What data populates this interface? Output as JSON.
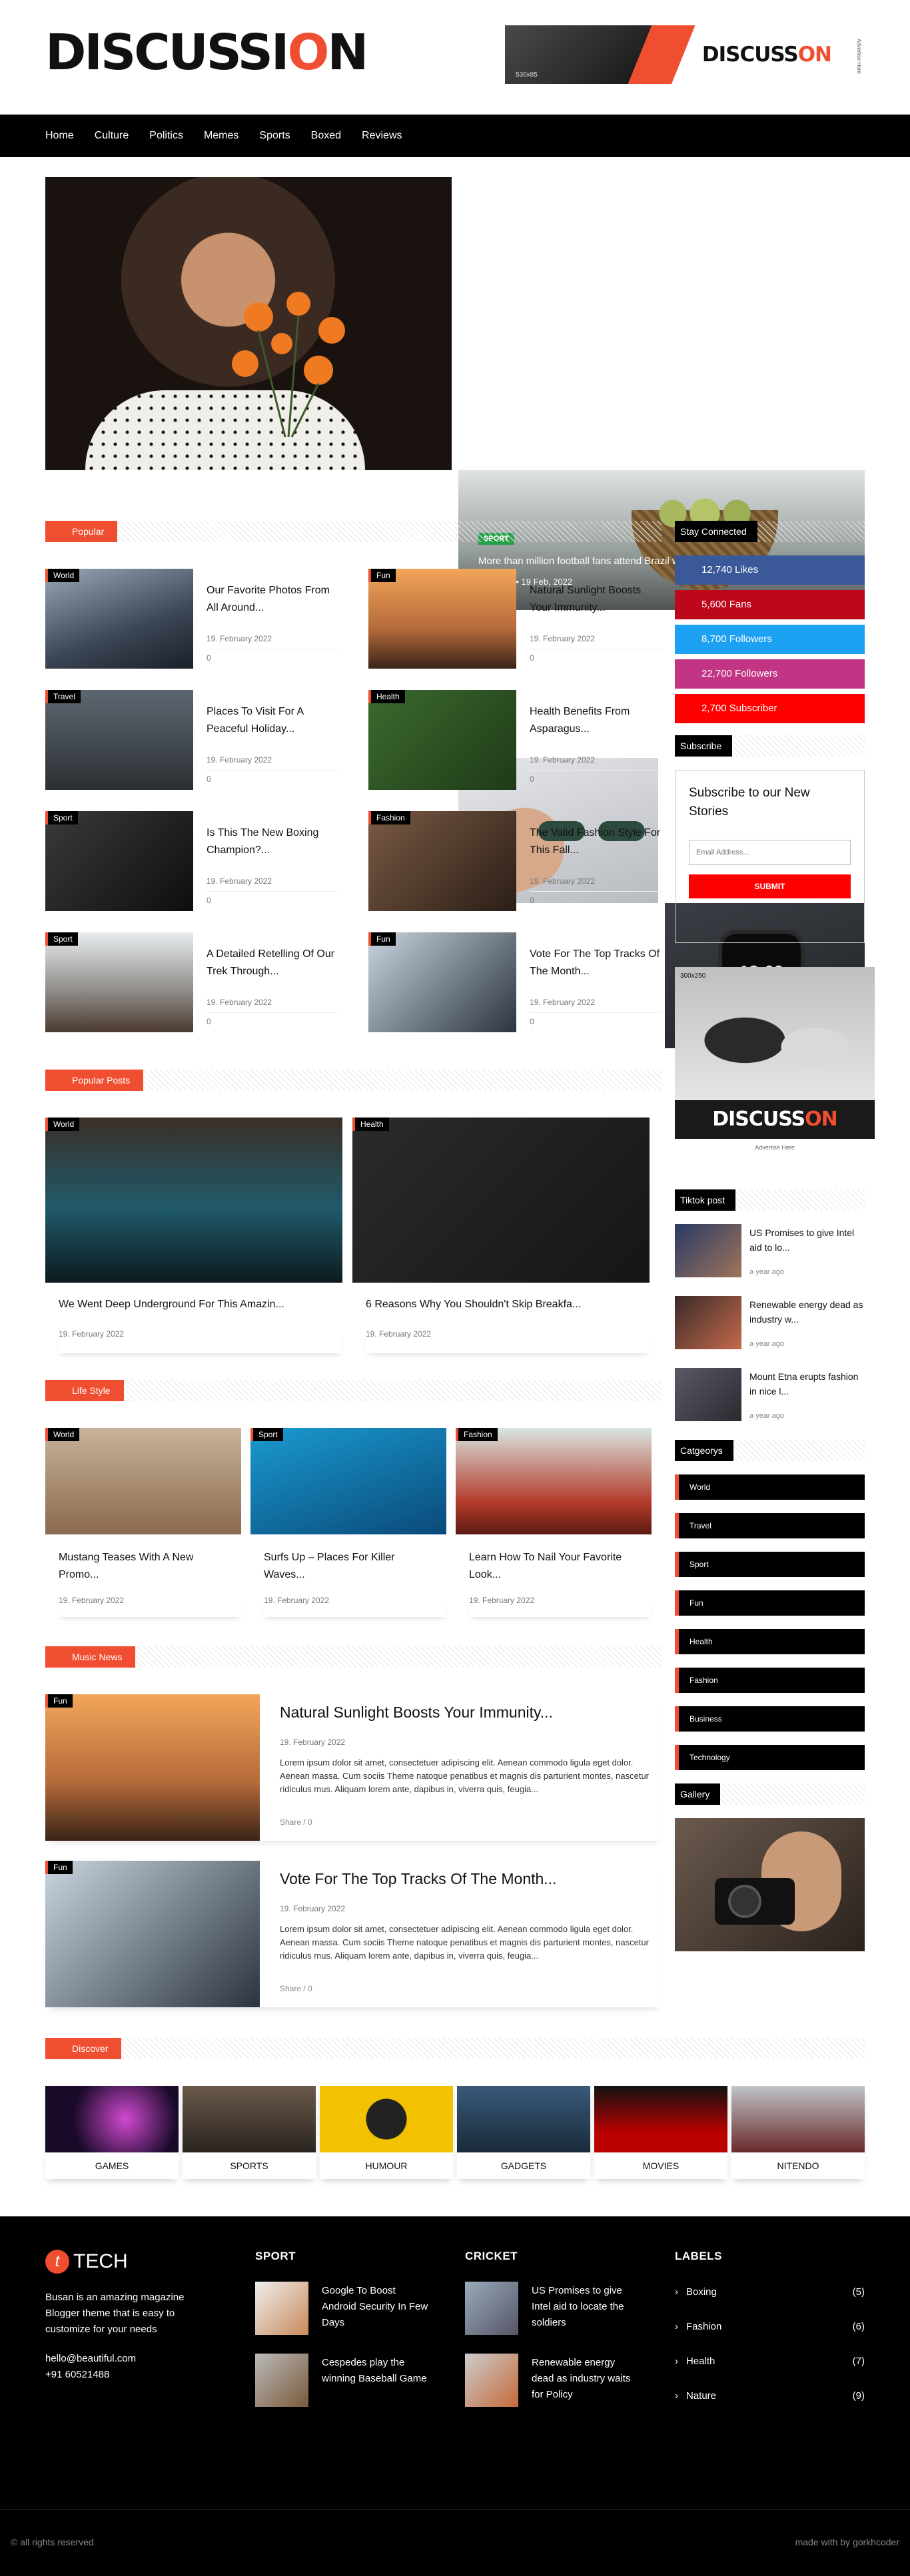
{
  "brand": {
    "logo_pre": "DISCUSSI",
    "logo_o": "O",
    "logo_post": "N"
  },
  "header_ad": {
    "size": "530x85",
    "logo_pre": "DISCUSS",
    "logo_post": "ON",
    "tag": "Advertise Here"
  },
  "nav": [
    "Home",
    "Culture",
    "Politics",
    "Memes",
    "Sports",
    "Boxed",
    "Reviews"
  ],
  "hero": {
    "top": {
      "badge": "SPORT",
      "title": "More than million football fans attend Brazil world cup",
      "meta": "by admin • 19 Feb, 2022"
    },
    "watch_time": "13:09"
  },
  "popular": {
    "label": "Popular",
    "items": [
      {
        "cat": "World",
        "title": "Our Favorite Photos From All Around...",
        "date": "19. February 2022",
        "count": "0"
      },
      {
        "cat": "Fun",
        "title": "Natural Sunlight Boosts Your Immunity...",
        "date": "19. February 2022",
        "count": "0"
      },
      {
        "cat": "Travel",
        "title": "Places To Visit For A Peaceful Holiday...",
        "date": "19. February 2022",
        "count": "0"
      },
      {
        "cat": "Health",
        "title": "Health Benefits From Asparagus...",
        "date": "19. February 2022",
        "count": "0"
      },
      {
        "cat": "Sport",
        "title": "Is This The New Boxing Champion?...",
        "date": "19. February 2022",
        "count": "0"
      },
      {
        "cat": "Fashion",
        "title": "The Valid Fashion Style For This Fall...",
        "date": "19. February 2022",
        "count": "0"
      },
      {
        "cat": "Sport",
        "title": "A Detailed Retelling Of Our Trek Through...",
        "date": "19. February 2022",
        "count": "0"
      },
      {
        "cat": "Fun",
        "title": "Vote For The Top Tracks Of The Month...",
        "date": "19. February 2022",
        "count": "0"
      }
    ]
  },
  "popular_posts": {
    "label": "Popular Posts",
    "items": [
      {
        "cat": "World",
        "title": "We Went Deep Underground For This Amazin...",
        "date": "19. February 2022"
      },
      {
        "cat": "Health",
        "title": "6 Reasons Why You Shouldn't Skip Breakfa...",
        "date": "19. February 2022"
      }
    ]
  },
  "life_style": {
    "label": "Life Style",
    "items": [
      {
        "cat": "World",
        "title": "Mustang Teases With A New Promo...",
        "date": "19. February 2022"
      },
      {
        "cat": "Sport",
        "title": "Surfs Up – Places For Killer Waves...",
        "date": "19. February 2022"
      },
      {
        "cat": "Fashion",
        "title": "Learn How To Nail Your Favorite Look...",
        "date": "19. February 2022"
      }
    ]
  },
  "music_news": {
    "label": "Music News",
    "items": [
      {
        "cat": "Fun",
        "title": "Natural Sunlight Boosts Your Immunity...",
        "date": "19. February 2022",
        "excerpt": "Lorem ipsum dolor sit amet, consectetuer adipiscing elit. Aenean commodo ligula eget dolor. Aenean massa. Cum sociis Theme natoque penatibus et magnis dis parturient montes, nascetur ridiculus mus. Aliquam lorem ante, dapibus in, viverra quis, feugia...",
        "share": "Share / 0"
      },
      {
        "cat": "Fun",
        "title": "Vote For The Top Tracks Of The Month...",
        "date": "19. February 2022",
        "excerpt": "Lorem ipsum dolor sit amet, consectetuer adipiscing elit. Aenean commodo ligula eget dolor. Aenean massa. Cum sociis Theme natoque penatibus et magnis dis parturient montes, nascetur ridiculus mus. Aliquam lorem ante, dapibus in, viverra quis, feugia...",
        "share": "Share / 0"
      }
    ]
  },
  "sidebar": {
    "stay_connected": "Stay Connected",
    "social": [
      {
        "text": "12,740 Likes",
        "color": "#3b5998"
      },
      {
        "text": "5,600 Fans",
        "color": "#bd081c"
      },
      {
        "text": "8,700 Followers",
        "color": "#1da1f2"
      },
      {
        "text": "22,700 Followers",
        "color": "#c13584"
      },
      {
        "text": "2,700 Subscriber",
        "color": "#ff0000"
      }
    ],
    "subscribe_label": "Subscribe",
    "subscribe_heading": "Subscribe to our New Stories",
    "email_placeholder": "Email Address...",
    "submit": "SUBMIT",
    "ad": {
      "size": "300x250",
      "logo_pre": "DISCUSS",
      "logo_post": "ON",
      "note": "Advertise Here"
    },
    "tiktok_label": "Tiktok post",
    "tiktok": [
      {
        "title": "US Promises to give Intel aid to lo...",
        "date": "a year ago"
      },
      {
        "title": "Renewable energy dead as industry w...",
        "date": "a year ago"
      },
      {
        "title": "Mount Etna erupts fashion in nice l...",
        "date": "a year ago"
      }
    ],
    "categories_label": "Catgeorys",
    "categories": [
      "World",
      "Travel",
      "Sport",
      "Fun",
      "Health",
      "Fashion",
      "Business",
      "Technology"
    ],
    "gallery_label": "Gallery"
  },
  "discover": {
    "label": "Discover",
    "items": [
      "GAMES",
      "SPORTS",
      "HUMOUR",
      "GADGETS",
      "MOVIES",
      "NITENDO"
    ]
  },
  "footer": {
    "logo_letter": "t",
    "logo_text": "TECH",
    "about": "Busan is an amazing magazine Blogger theme that is easy to customize for your needs",
    "email": "hello@beautiful.com",
    "phone": "+91 60521488",
    "sport_heading": "SPORT",
    "sport_posts": [
      "Google To Boost Android Security In Few Days",
      "Cespedes play the winning Baseball Game"
    ],
    "cricket_heading": "CRICKET",
    "cricket_posts": [
      "US Promises to give Intel aid to locate the soldiers",
      "Renewable energy dead as industry waits for Policy"
    ],
    "labels_heading": "LABELS",
    "labels": [
      {
        "name": "Boxing",
        "count": "(5)"
      },
      {
        "name": "Fashion",
        "count": "(6)"
      },
      {
        "name": "Health",
        "count": "(7)"
      },
      {
        "name": "Nature",
        "count": "(9)"
      }
    ],
    "copyright": "© all rights reserved",
    "made_with": "made with by gorkhcoder"
  }
}
